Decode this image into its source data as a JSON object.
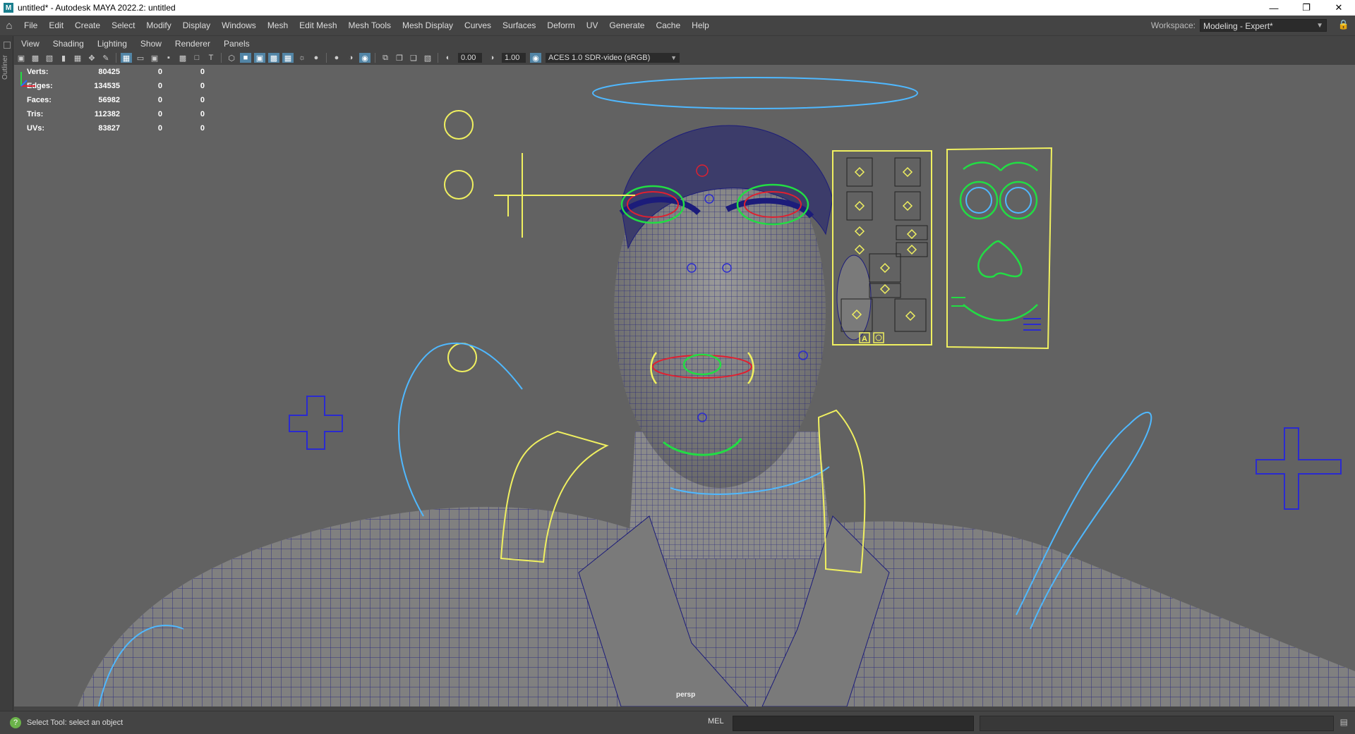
{
  "window": {
    "title": "untitled* - Autodesk MAYA 2022.2: untitled",
    "icon": "maya-app-icon",
    "buttons": [
      "minimize-icon",
      "restore-icon",
      "close-icon"
    ]
  },
  "menubar": {
    "items": [
      "File",
      "Edit",
      "Create",
      "Select",
      "Modify",
      "Display",
      "Windows",
      "Mesh",
      "Edit Mesh",
      "Mesh Tools",
      "Mesh Display",
      "Curves",
      "Surfaces",
      "Deform",
      "UV",
      "Generate",
      "Cache",
      "Help"
    ],
    "workspace_label": "Workspace:",
    "workspace_value": "Modeling - Expert*"
  },
  "outliner": {
    "label": "Outliner"
  },
  "panel_menu": {
    "items": [
      "View",
      "Shading",
      "Lighting",
      "Show",
      "Renderer",
      "Panels"
    ]
  },
  "viewport_toolbar": {
    "exposure": "0.00",
    "gamma": "1.00",
    "color_space": "ACES 1.0 SDR-video (sRGB)"
  },
  "hud": {
    "rows": [
      {
        "label": "Verts:",
        "v1": "80425",
        "v2": "0",
        "v3": "0"
      },
      {
        "label": "Edges:",
        "v1": "134535",
        "v2": "0",
        "v3": "0"
      },
      {
        "label": "Faces:",
        "v1": "56982",
        "v2": "0",
        "v3": "0"
      },
      {
        "label": "Tris:",
        "v1": "112382",
        "v2": "0",
        "v3": "0"
      },
      {
        "label": "UVs:",
        "v1": "83827",
        "v2": "0",
        "v3": "0"
      }
    ],
    "camera": "persp"
  },
  "facial_panel": {
    "button_a": "A"
  },
  "colors": {
    "mesh_wire": "#1c1c7a",
    "ctrl_yellow": "#f0f060",
    "ctrl_blue": "#4fb8ff",
    "ctrl_green": "#22dd44",
    "ctrl_red": "#e02030",
    "ctrl_navy": "#2a2ad0"
  },
  "statusbar": {
    "help_text": "Select Tool: select an object",
    "mel_label": "MEL"
  }
}
